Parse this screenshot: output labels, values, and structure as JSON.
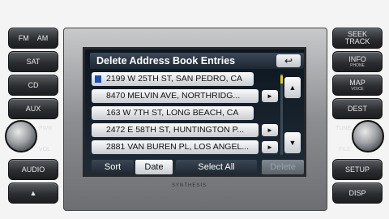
{
  "left_buttons": [
    {
      "label": "FM",
      "label2": "AM"
    },
    {
      "label": "SAT"
    },
    {
      "label": "CD"
    },
    {
      "label": "AUX"
    },
    {
      "label": "AUDIO"
    },
    {
      "label": "▲"
    }
  ],
  "left_knob": {
    "label_top": "PWR",
    "label_bottom": "VOL"
  },
  "right_buttons": [
    {
      "label": "SEEK",
      "label2": "TRACK"
    },
    {
      "label": "INFO",
      "sub": "PHONE"
    },
    {
      "label": "MAP",
      "sub": "VOICE"
    },
    {
      "label": "DEST"
    },
    {
      "label": "SETUP"
    },
    {
      "label": "DISP"
    }
  ],
  "right_knob": {
    "label_top": "TUNE",
    "label_bottom": "FILE"
  },
  "screen": {
    "title": "Delete Address Book Entries",
    "back_icon": "↩",
    "entries": [
      {
        "text": "2199 W 25TH ST, SAN PEDRO, CA",
        "flag": true,
        "arrow": false
      },
      {
        "text": "8470 MELVIN AVE, NORTHRIDG...",
        "flag": false,
        "arrow": true
      },
      {
        "text": "163 W 7TH ST, LONG BEACH, CA",
        "flag": false,
        "arrow": false
      },
      {
        "text": "2472 E 58TH ST, HUNTINGTON P...",
        "flag": false,
        "arrow": true
      },
      {
        "text": "2881 VAN BUREN PL, LOS ANGEL...",
        "flag": false,
        "arrow": true
      }
    ],
    "arrow_icon": "►",
    "scroll_up_icon": "▲",
    "scroll_down_icon": "▼",
    "bottom": {
      "sort": "Sort",
      "date": "Date",
      "select_all": "Select All",
      "delete": "Delete"
    }
  },
  "brand": "SYNTHESIS",
  "accent_yellow": "#e3d400"
}
